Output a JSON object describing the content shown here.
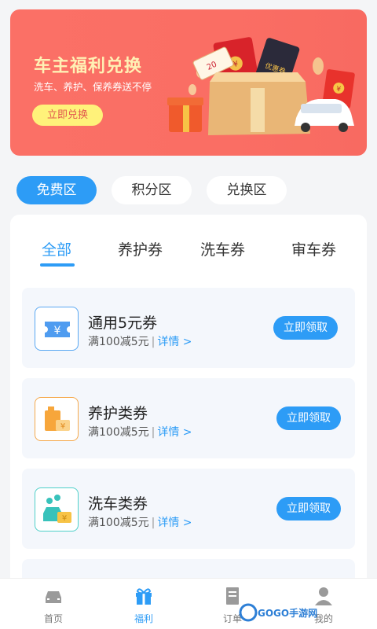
{
  "banner": {
    "title": "车主福利兑换",
    "subtitle": "洗车、养护、保养券送不停",
    "button": "立即兑换",
    "art_labels": {
      "voucher1": "20",
      "voucher2": "优惠券",
      "envelope_sign": "¥"
    }
  },
  "zones": [
    {
      "label": "免费区",
      "active": true
    },
    {
      "label": "积分区",
      "active": false
    },
    {
      "label": "兑换区",
      "active": false
    }
  ],
  "categories": [
    {
      "label": "全部",
      "active": true
    },
    {
      "label": "养护券",
      "active": false
    },
    {
      "label": "洗车券",
      "active": false
    },
    {
      "label": "审车券",
      "active": false
    }
  ],
  "coupons": [
    {
      "title": "通用5元券",
      "condition": "满100减5元",
      "separator": "|",
      "detail": "详情 >",
      "button": "立即领取",
      "icon": "ticket-yen-icon"
    },
    {
      "title": "养护类券",
      "condition": "满100减5元",
      "separator": "|",
      "detail": "详情 >",
      "button": "立即领取",
      "icon": "oil-can-icon"
    },
    {
      "title": "洗车类券",
      "condition": "满100减5元",
      "separator": "|",
      "detail": "详情 >",
      "button": "立即领取",
      "icon": "car-wash-icon"
    }
  ],
  "nav": [
    {
      "label": "首页",
      "icon": "car-icon",
      "active": false
    },
    {
      "label": "福利",
      "icon": "gift-icon",
      "active": true
    },
    {
      "label": "订单",
      "icon": "document-icon",
      "active": false
    },
    {
      "label": "我的",
      "icon": "user-icon",
      "active": false
    }
  ],
  "watermark": "GOGO手游网",
  "colors": {
    "accent": "#2d9cf6",
    "banner": "#fa6e64",
    "banner_button": "#fff27a"
  }
}
